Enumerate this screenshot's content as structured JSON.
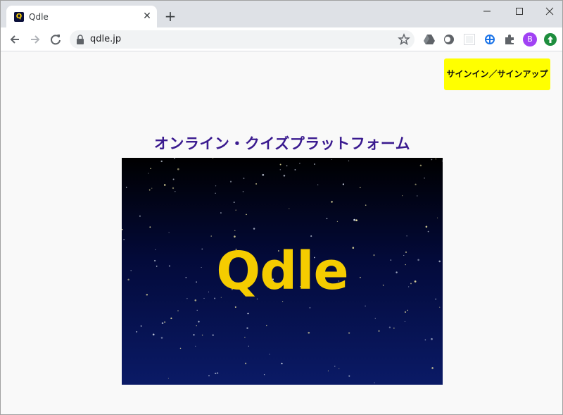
{
  "browser": {
    "tab": {
      "title": "Qdle",
      "favicon_letter": "Q",
      "close_glyph": "✕"
    },
    "new_tab_glyph": "+",
    "window_controls": {
      "minimize": "—",
      "maximize": "☐",
      "close": "✕"
    },
    "url": "qdle.jp",
    "profile_initial": "B",
    "icons": [
      "back-arrow-icon",
      "forward-arrow-icon",
      "reload-icon",
      "lock-icon",
      "star-icon",
      "google-drive-icon",
      "extension-circle-icon",
      "extension-square-icon",
      "extension-blue-icon",
      "extensions-puzzle-icon",
      "update-arrow-icon"
    ]
  },
  "page": {
    "signin_label": "サインイン／サインアップ",
    "heading": "オンライン・クイズプラットフォーム",
    "hero_logo_text": "Qdle"
  },
  "colors": {
    "signin_bg": "#ffff00",
    "heading": "#3a1a8f",
    "logo": "#f5cc00",
    "hero_top": "#000000",
    "hero_bottom": "#0a1a66"
  }
}
